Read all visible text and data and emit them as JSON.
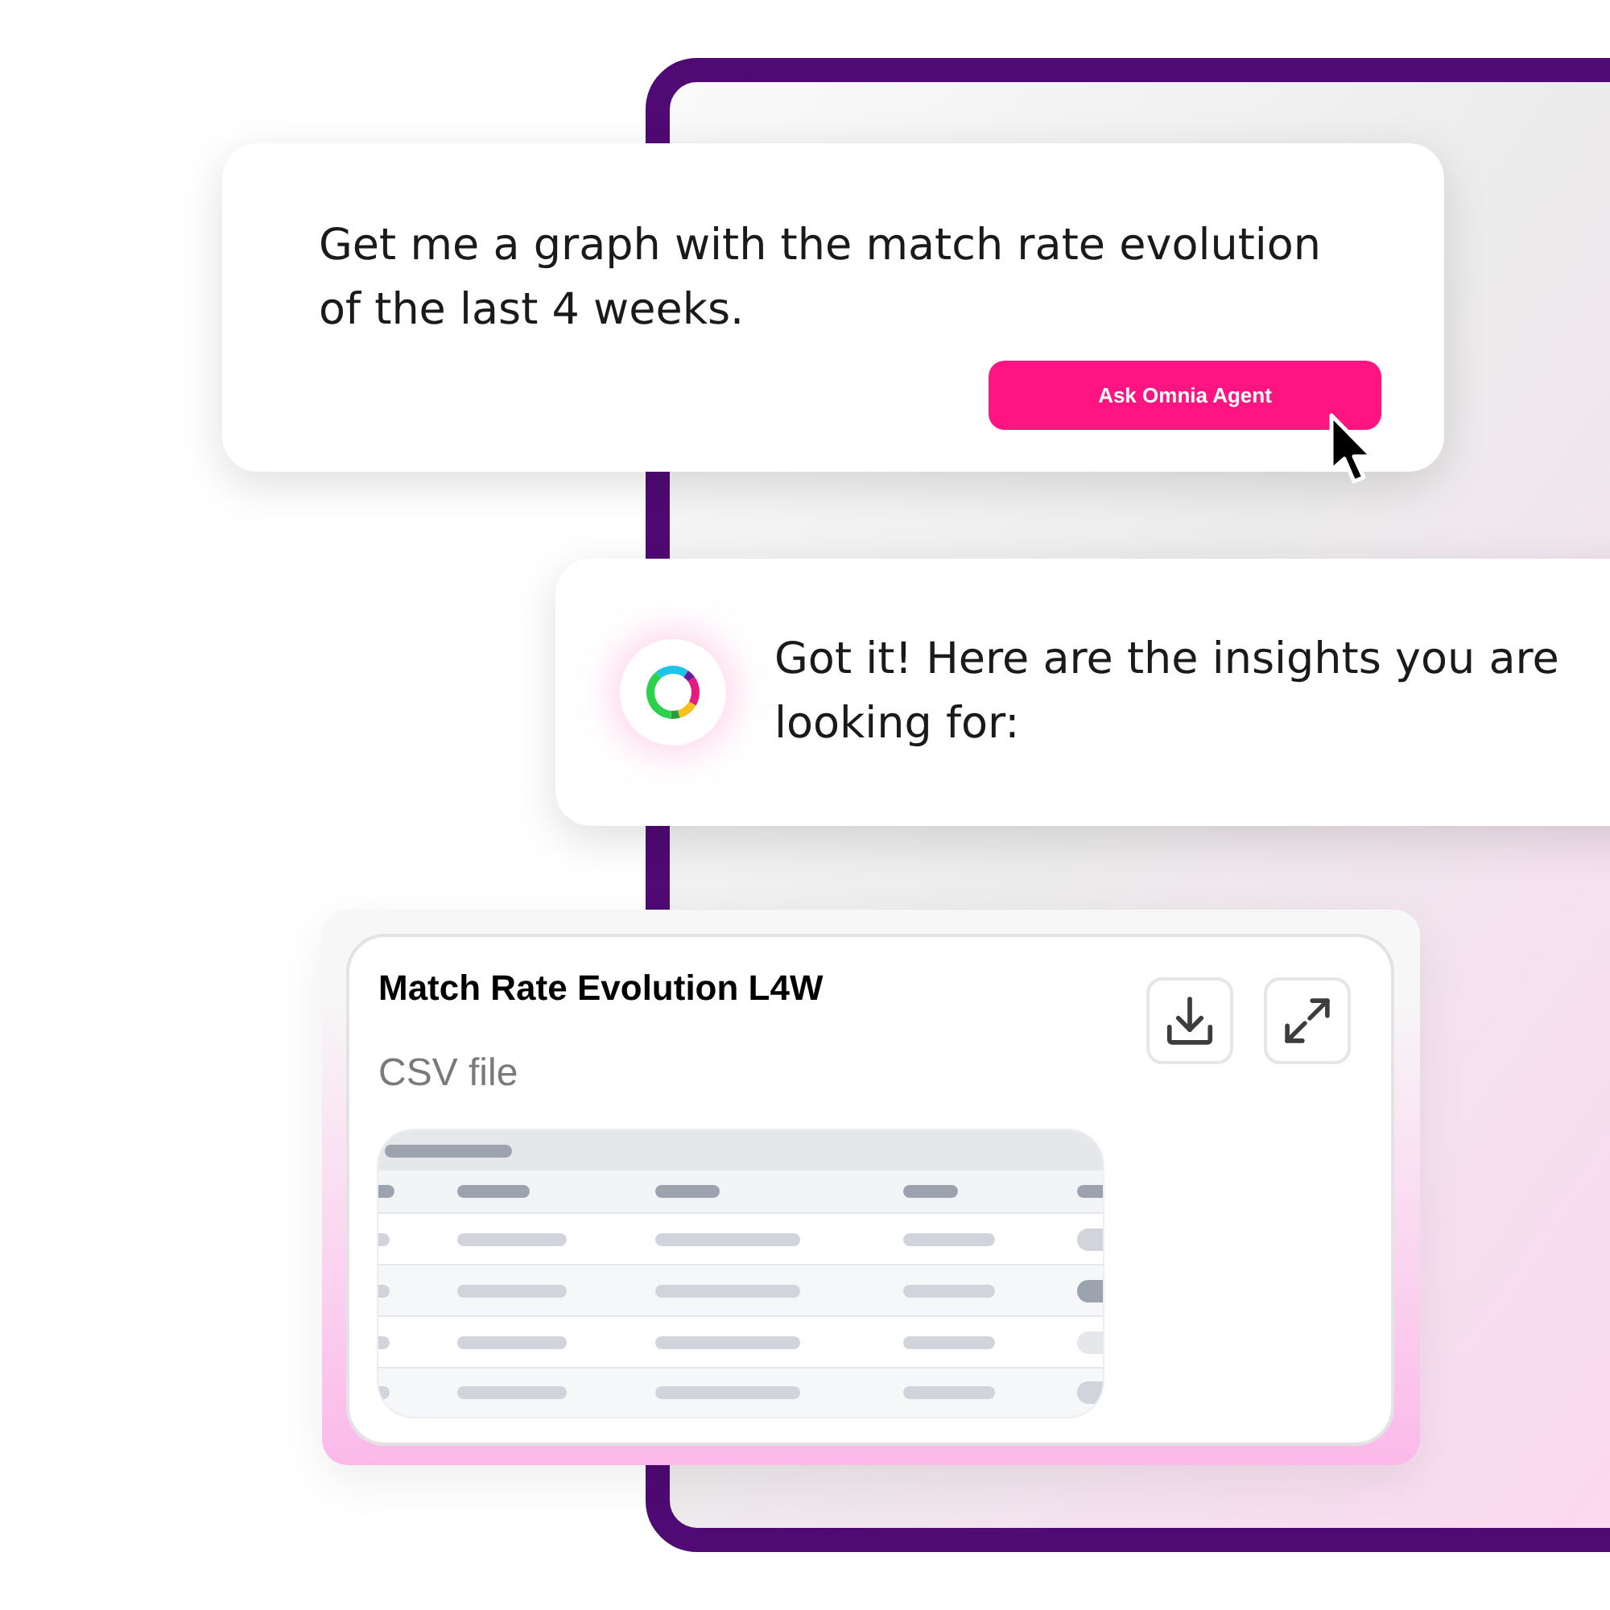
{
  "prompt_card": {
    "text": "Get me a graph with the match rate evolution of the last 4 weeks.",
    "button": "Ask Omnia Agent"
  },
  "response_card": {
    "text": "Got it! Here are the insights you are looking for:"
  },
  "file_card": {
    "title": "Match Rate Evolution L4W",
    "subtitle": "CSV file"
  }
}
